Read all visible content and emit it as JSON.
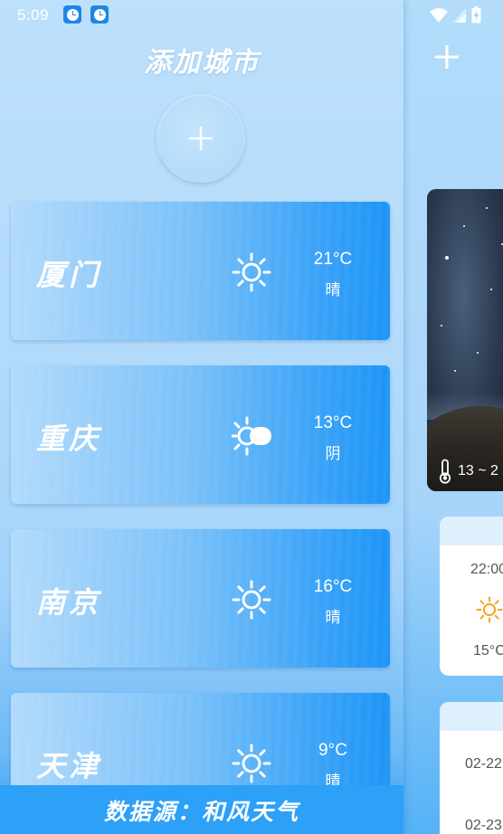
{
  "status_bar": {
    "time": "5:09",
    "notification_icons": [
      "clock-app-icon",
      "clock-app-icon"
    ],
    "system_icons": [
      "wifi-icon",
      "signal-icon",
      "battery-charging-icon"
    ]
  },
  "drawer": {
    "title": "添加城市",
    "add_button_icon": "plus-icon",
    "cities": [
      {
        "name": "厦门",
        "temp": "21°C",
        "condition": "晴",
        "icon": "sun-icon"
      },
      {
        "name": "重庆",
        "temp": "13°C",
        "condition": "阴",
        "icon": "overcast-icon"
      },
      {
        "name": "南京",
        "temp": "16°C",
        "condition": "晴",
        "icon": "sun-icon"
      },
      {
        "name": "天津",
        "temp": "9°C",
        "condition": "晴",
        "icon": "sun-icon"
      }
    ],
    "data_source": "数据源：和风天气"
  },
  "right_page": {
    "add_icon": "plus-icon",
    "temp_range": "13 ~ 2",
    "hourly": {
      "time": "22:00",
      "temp": "15°C",
      "icon": "sun-icon"
    },
    "daily": [
      {
        "date": "02-22"
      },
      {
        "date": "02-23"
      }
    ]
  },
  "colors": {
    "accent": "#1a93f6",
    "sun_icon_white": "#ffffff",
    "sun_icon_orange": "#f6a623",
    "card_bg": "#ffffff"
  }
}
